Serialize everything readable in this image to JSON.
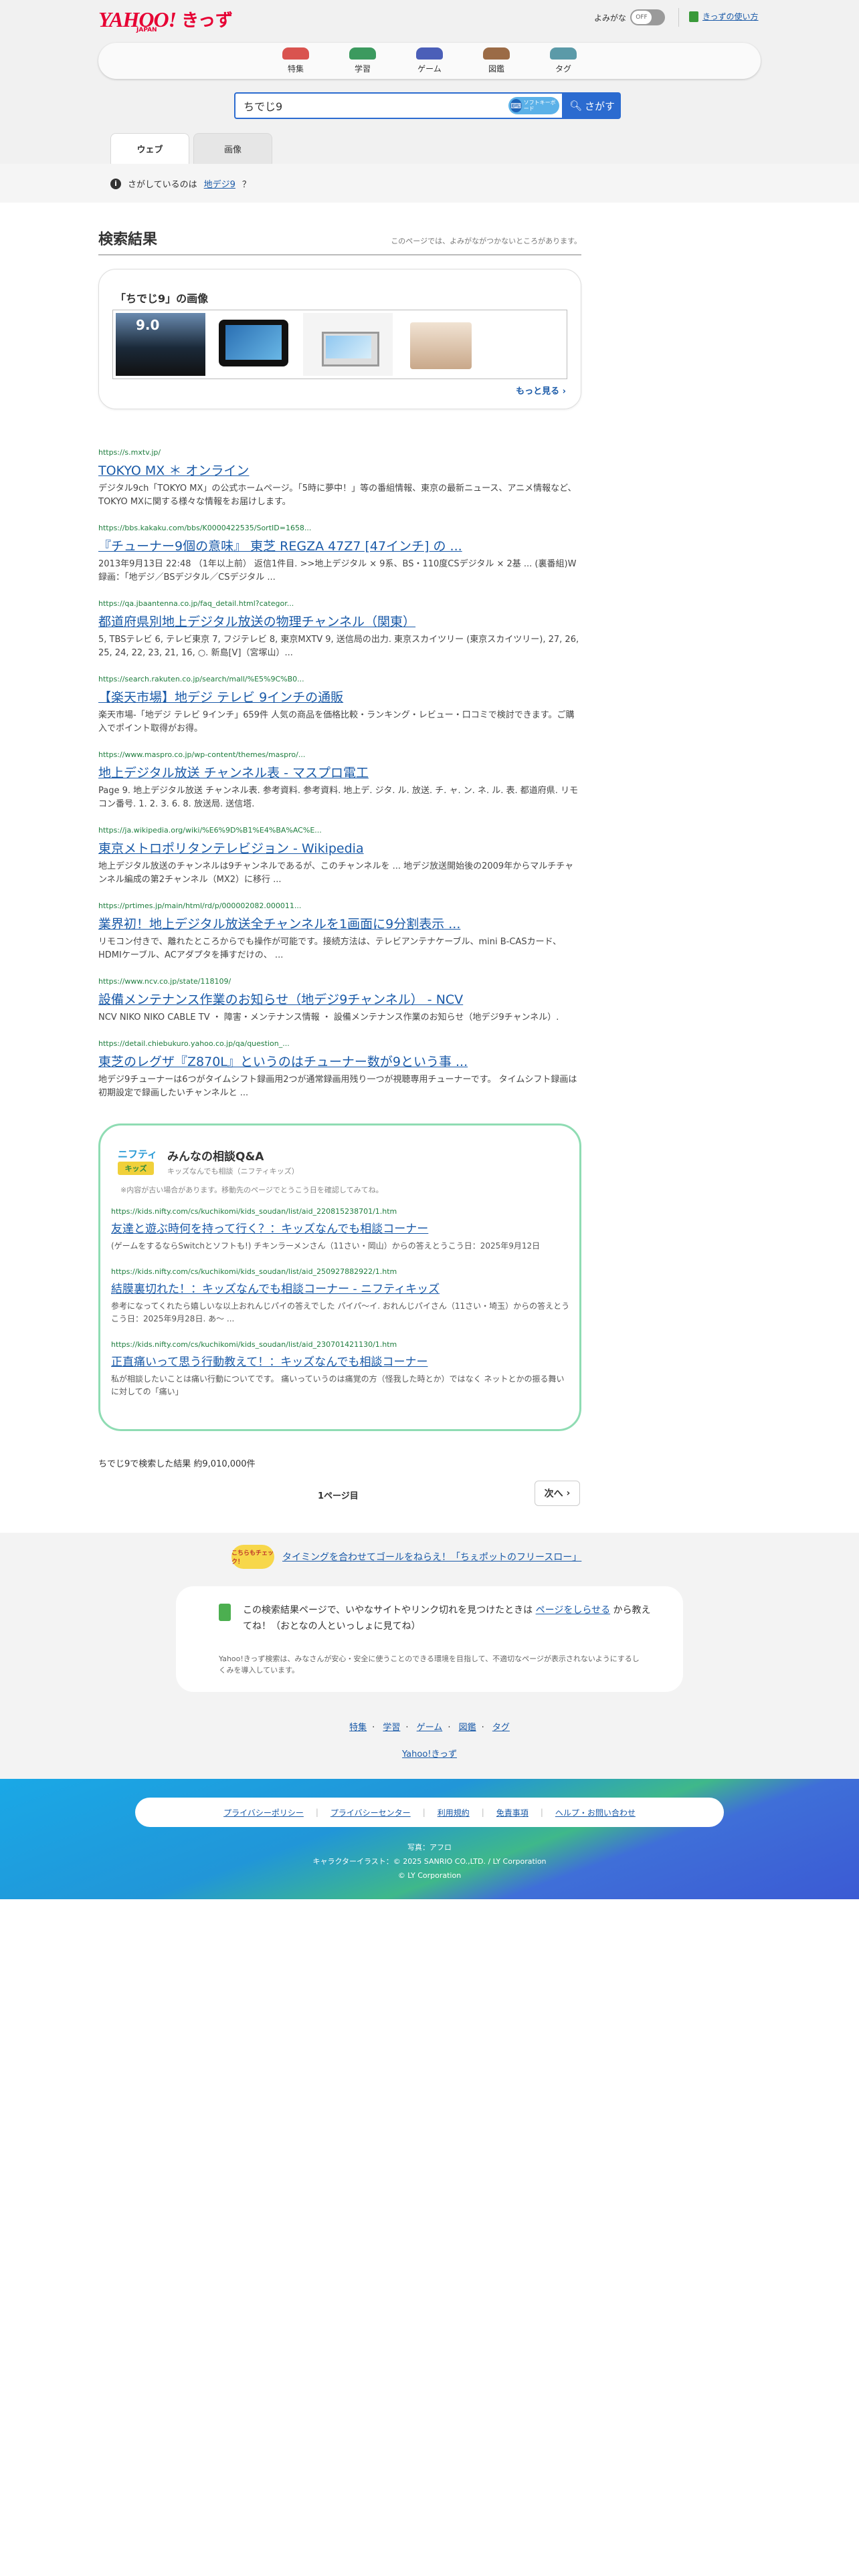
{
  "header": {
    "logo_main": "YAHOO!",
    "logo_kids": "きっず",
    "logo_sub": "JAPAN",
    "yomigana_label": "よみがな",
    "toggle_state": "OFF",
    "howto_link": "きっずの使い方"
  },
  "nav": [
    {
      "label": "特集",
      "color": "#d9534f"
    },
    {
      "label": "学習",
      "color": "#3c9a5f"
    },
    {
      "label": "ゲーム",
      "color": "#4b5fb8"
    },
    {
      "label": "図鑑",
      "color": "#9b6b46"
    },
    {
      "label": "タグ",
      "color": "#5b9aa8"
    }
  ],
  "search": {
    "query": "ちでじ9",
    "keyboard_label": "ソフトキーボード",
    "button_label": "さがす"
  },
  "tabs": [
    {
      "label": "ウェブ",
      "active": true
    },
    {
      "label": "画像",
      "active": false
    }
  ],
  "notice": {
    "prefix": "さがしているのは",
    "suggestion": "地デジ9",
    "suffix": "？"
  },
  "results_header": {
    "title": "検索結果",
    "note": "このページでは、よみがながつかないところがあります。"
  },
  "image_block": {
    "title": "「ちでじ9」の画像",
    "more": "もっと見る"
  },
  "results": [
    {
      "url": "https://s.mxtv.jp/",
      "title": "TOKYO MX ＊ オンライン",
      "desc": "デジタル9ch「TOKYO MX」の公式ホームページ。「5時に夢中！」等の番組情報、東京の最新ニュース、アニメ情報など、TOKYO MXに関する様々な情報をお届けします。"
    },
    {
      "url": "https://bbs.kakaku.com/bbs/K0000422535/SortID=1658...",
      "title": "『チューナー9個の意味』 東芝 REGZA 47Z7 [47インチ] の ...",
      "desc": "2013年9月13日 22:48 （1年以上前） 返信1件目. >>地上デジタル × 9系、BS・110度CSデジタル × 2基 ... (裏番組)W録画：「地デジ／BSデジタル／CSデジタル ..."
    },
    {
      "url": "https://qa.jbaantenna.co.jp/faq_detail.html?categor...",
      "title": "都道府県別地上デジタル放送の物理チャンネル（関東）",
      "desc": "5, TBSテレビ 6, テレビ東京 7, フジテレビ 8, 東京MXTV 9, 送信局の出力. 東京スカイツリー (東京スカイツリー), 27, 26, 25, 24, 22, 23, 21, 16, ○. 新島[V]（宮塚山）..."
    },
    {
      "url": "https://search.rakuten.co.jp/search/mall/%E5%9C%B0...",
      "title": "【楽天市場】地デジ テレビ 9インチの通販",
      "desc": "楽天市場-「地デジ テレビ 9インチ」659件 人気の商品を価格比較・ランキング・レビュー・口コミで検討できます。ご購入でポイント取得がお得。"
    },
    {
      "url": "https://www.maspro.co.jp/wp-content/themes/maspro/...",
      "title": "地上デジタル放送 チャンネル表 - マスプロ電工",
      "desc": "Page 9. 地上デジタル放送 チャンネル表. 参考資料. 参考資料. 地上デ. ジタ. ル. 放送. チ. ャ. ン. ネ. ル. 表. 都道府県. リモコン番号. 1. 2. 3. 6. 8. 放送局. 送信塔."
    },
    {
      "url": "https://ja.wikipedia.org/wiki/%E6%9D%B1%E4%BA%AC%E...",
      "title": "東京メトロポリタンテレビジョン - Wikipedia",
      "desc": "地上デジタル放送のチャンネルは9チャンネルであるが、このチャンネルを ... 地デジ放送開始後の2009年からマルチチャンネル編成の第2チャンネル（MX2）に移行 ..."
    },
    {
      "url": "https://prtimes.jp/main/html/rd/p/000002082.000011...",
      "title": "業界初！地上デジタル放送全チャンネルを1画面に9分割表示 ...",
      "desc": "リモコン付きで、離れたところからでも操作が可能です。接続方法は、テレビアンテナケーブル、mini B-CASカード、HDMIケーブル、ACアダプタを挿すだけの、 ..."
    },
    {
      "url": "https://www.ncv.co.jp/state/118109/",
      "title": "設備メンテナンス作業のお知らせ（地デジ9チャンネル） - NCV",
      "desc": "NCV NIKO NIKO CABLE TV ・ 障害・メンテナンス情報 ・ 設備メンテナンス作業のお知らせ（地デジ9チャンネル）."
    },
    {
      "url": "https://detail.chiebukuro.yahoo.co.jp/qa/question_...",
      "title": "東芝のレグザ『Z870L』というのはチューナー数が9という事 ...",
      "desc": "地デジ9チューナーは6つがタイムシフト録画用2つが通常録画用残り一つが視聴専用チューナーです。 タイムシフト録画は初期設定で録画したいチャンネルと ..."
    }
  ],
  "qa": {
    "brand1": "ニフティ",
    "brand2": "キッズ",
    "title": "みんなの相談Q&A",
    "subtitle": "キッズなんでも相談（ニフティキッズ）",
    "notice": "※内容が古い場合があります。移動先のページでとうこう日を確認してみてね。",
    "items": [
      {
        "url": "https://kids.nifty.com/cs/kuchikomi/kids_soudan/list/aid_220815238701/1.htm",
        "title": "友達と遊ぶ時何を持って行く？：キッズなんでも相談コーナー",
        "desc": "(ゲームをするならSwitchとソフトも!) チキンラーメンさん（11さい・岡山）からの答えとうこう日：2025年9月12日"
      },
      {
        "url": "https://kids.nifty.com/cs/kuchikomi/kids_soudan/list/aid_250927882922/1.htm",
        "title": "結膜裏切れた！：キッズなんでも相談コーナー - ニフティキッズ",
        "desc": "参考になってくれたら嬉しいな以上おれんじパイの答えでした パイパ〜イ. おれんじパイさん（11さい・埼玉）からの答えとうこう日：2025年9月28日. あ〜 ..."
      },
      {
        "url": "https://kids.nifty.com/cs/kuchikomi/kids_soudan/list/aid_230701421130/1.htm",
        "title": "正直痛いって思う行動教えて！：キッズなんでも相談コーナー",
        "desc": "私が相談したいことは痛い行動についてです。 痛いっていうのは痛覚の方（怪我した時とか）ではなく ネットとかの振る舞いに対しての「痛い」"
      }
    ]
  },
  "result_count": "ちでじ9で検索した結果 約9,010,000件",
  "pagination": {
    "current": "1ページ目",
    "next": "次へ"
  },
  "promo": {
    "badge": "こちらもチェック！",
    "link": "タイミングを合わせてゴールをねらえ！「ちぇポットのフリースロー」"
  },
  "report": {
    "text_before": "この検索結果ページで、いやなサイトやリンク切れを見つけたときは",
    "link": "ページをしらせる",
    "text_after": "から教えてね！（おとなの人といっしょに見てね）",
    "note": "Yahoo!きっず検索は、みなさんが安心・安全に使うことのできる環境を目指して、不適切なページが表示されないようにするしくみを導入しています。"
  },
  "footer_links": [
    "特集",
    "学習",
    "ゲーム",
    "図鑑",
    "タグ"
  ],
  "footer_home": "Yahoo!きっず",
  "footer_policy": [
    "プライバシーポリシー",
    "プライバシーセンター",
    "利用規約",
    "免責事項",
    "ヘルプ・お問い合わせ"
  ],
  "credits": [
    "写真：アフロ",
    "キャラクターイラスト：© 2025 SANRIO CO.,LTD. / LY Corporation",
    "© LY Corporation"
  ]
}
